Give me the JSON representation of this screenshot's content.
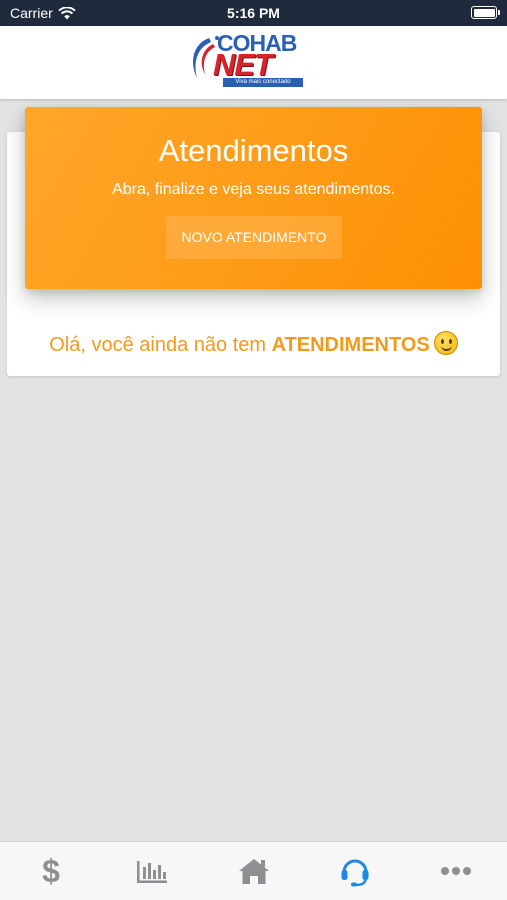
{
  "status_bar": {
    "carrier": "Carrier",
    "time": "5:16 PM",
    "battery_level": 1.0
  },
  "logo": {
    "top_text": "COHAB",
    "main_text": "NET",
    "tagline": "Viva mais conectado"
  },
  "banner": {
    "title": "Atendimentos",
    "subtitle": "Abra, finalize e veja seus atendimentos.",
    "button_label": "NOVO ATENDIMENTO"
  },
  "empty_state": {
    "text": "Olá, você ainda não tem ",
    "highlight": "ATENDIMENTOS"
  },
  "tab_bar": {
    "items": [
      {
        "icon": "dollar-icon",
        "active": false
      },
      {
        "icon": "chart-icon",
        "active": false
      },
      {
        "icon": "home-icon",
        "active": false
      },
      {
        "icon": "headset-icon",
        "active": true
      },
      {
        "icon": "more-icon",
        "active": false
      }
    ]
  },
  "colors": {
    "accent": "#fe9b16",
    "tab_active": "#1e88e5",
    "tab_inactive": "#8e8e93",
    "status_bar": "#1f2a3d"
  }
}
